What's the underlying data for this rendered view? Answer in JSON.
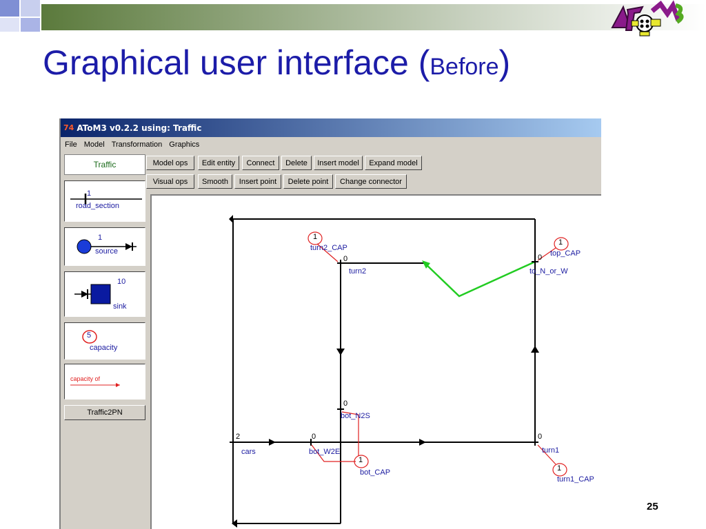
{
  "slide": {
    "title_main": "Graphical user interface (",
    "title_small": "Before",
    "title_close": ")",
    "page_number": "25"
  },
  "window": {
    "title": "AToM3 v0.2.2 using: Traffic",
    "menu": [
      "File",
      "Model",
      "Transformation",
      "Graphics"
    ]
  },
  "toolbar": {
    "row1": [
      "Model ops",
      "Edit entity",
      "Connect",
      "Delete",
      "Insert model",
      "Expand model"
    ],
    "row2": [
      "Visual ops",
      "Smooth",
      "Insert point",
      "Delete point",
      "Change connector"
    ]
  },
  "palette": {
    "tab": "Traffic",
    "road_section": {
      "label": "road_section",
      "count": "1"
    },
    "source": {
      "label": "source",
      "count": "1"
    },
    "sink": {
      "label": "sink",
      "count": "10"
    },
    "capacity": {
      "label": "capacity",
      "count": "5"
    },
    "capacity_of": {
      "label": "capacity of"
    },
    "traffic2pn": "Traffic2PN"
  },
  "canvas": {
    "turn2_cap": {
      "label": "turn2_CAP",
      "value": "1"
    },
    "turn2": {
      "label": "turn2",
      "value": "0"
    },
    "top_cap": {
      "label": "top_CAP",
      "value": "1"
    },
    "to_n_or_w": {
      "label": "to_N_or_W",
      "value": "0"
    },
    "bot_n2s": {
      "label": "bot_N2S",
      "value": "0"
    },
    "cars": {
      "label": "cars",
      "value": "2"
    },
    "bot_w2e": {
      "label": "bot_W2E",
      "value": "0"
    },
    "bot_cap": {
      "label": "bot_CAP",
      "value": "1"
    },
    "turn1": {
      "label": "turn1",
      "value": "0"
    },
    "turn1_cap": {
      "label": "turn1_CAP",
      "value": "1"
    }
  },
  "colors": {
    "title_blue": "#1c1ca8",
    "label_blue": "#1a1aa0",
    "capacity_red": "#e02020",
    "green_link": "#22cc22"
  }
}
